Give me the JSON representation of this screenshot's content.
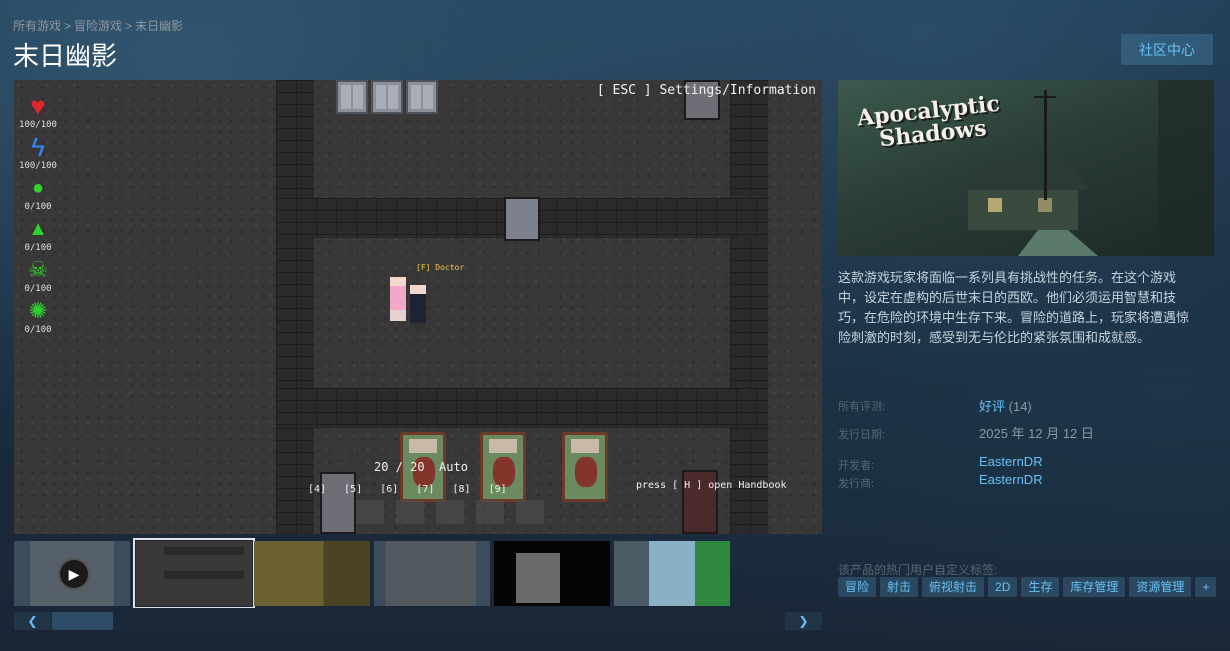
{
  "breadcrumb": {
    "items": [
      "所有游戏",
      "冒险游戏",
      "末日幽影"
    ],
    "separator": ">"
  },
  "title": "末日幽影",
  "community_button": "社区中心",
  "game_screenshot": {
    "hud": [
      {
        "icon": "heart-icon",
        "value": "100/100",
        "color": "#e0262a"
      },
      {
        "icon": "lightning-icon",
        "value": "100/100",
        "color": "#2a8bff"
      },
      {
        "icon": "stomach-icon",
        "value": "0/100",
        "color": "#2ed32e"
      },
      {
        "icon": "water-drop-icon",
        "value": "0/100",
        "color": "#2ed32e"
      },
      {
        "icon": "skull-icon",
        "value": "0/100",
        "color": "#2ed32e"
      },
      {
        "icon": "virus-icon",
        "value": "0/100",
        "color": "#2ed32e"
      }
    ],
    "esc_text": "[ ESC ] Settings/Information",
    "npc_label": "[F] Doctor",
    "ammo_text": "20 / 20  Auto",
    "slots_text": "[4]   [5]   [6]   [7]   [8]   [9]",
    "handbook_text": "press [ H ] open Handbook"
  },
  "thumbnails": [
    {
      "kind": "video",
      "selected": false
    },
    {
      "kind": "image",
      "selected": true
    },
    {
      "kind": "image",
      "selected": false
    },
    {
      "kind": "image",
      "selected": false
    },
    {
      "kind": "image",
      "selected": false
    },
    {
      "kind": "image",
      "selected": false
    }
  ],
  "capsule": {
    "title_line1": "Apocalyptic",
    "title_line2": "Shadows"
  },
  "description": "这款游戏玩家将面临一系列具有挑战性的任务。在这个游戏中，设定在虚构的后世末日的西欧。他们必须运用智慧和技巧，在危险的环境中生存下来。冒险的道路上，玩家将遭遇惊险刺激的时刻，感受到无与伦比的紧张氛围和成就感。",
  "reviews": {
    "label": "所有评测:",
    "summary": "好评",
    "count": "(14)"
  },
  "release": {
    "label": "发行日期:",
    "date": "2025 年 12 月 12 日"
  },
  "developer": {
    "label": "开发者:",
    "name": "EasternDR"
  },
  "publisher": {
    "label": "发行商:",
    "name": "EasternDR"
  },
  "tags": {
    "label": "该产品的热门用户自定义标签:",
    "items": [
      "冒险",
      "射击",
      "俯视射击",
      "2D",
      "生存",
      "库存管理",
      "资源管理",
      "+"
    ]
  },
  "colors": {
    "accent": "#67c1f5",
    "title": "#ffffff",
    "muted": "#8f98a0"
  }
}
